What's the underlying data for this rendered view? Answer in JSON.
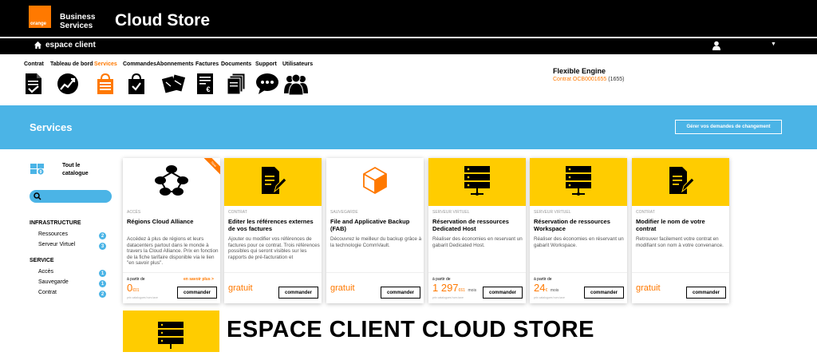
{
  "header": {
    "logo_text": "orange",
    "brand_line1": "Business",
    "brand_line2": "Services",
    "title": "Cloud Store",
    "espace_label": "espace client"
  },
  "nav": [
    {
      "label": "Contrat",
      "icon": "contract-icon"
    },
    {
      "label": "Tableau de bord",
      "icon": "dashboard-icon"
    },
    {
      "label": "Services",
      "icon": "shopping-bag-icon",
      "active": true
    },
    {
      "label": "Commandes",
      "icon": "orders-bag-icon"
    },
    {
      "label": "Abonnements",
      "icon": "subscriptions-icon"
    },
    {
      "label": "Factures",
      "icon": "invoice-icon"
    },
    {
      "label": "Documents",
      "icon": "documents-icon"
    },
    {
      "label": "Support",
      "icon": "support-chat-icon"
    },
    {
      "label": "Utilisateurs",
      "icon": "users-icon"
    }
  ],
  "account": {
    "name": "Flexible Engine",
    "contract_prefix": "Contrat OCB0001655",
    "contract_suffix": "(1655)"
  },
  "banner": {
    "title": "Services",
    "button_label": "Gérer vos demandes de changement"
  },
  "sidebar": {
    "catalog_badge": "9",
    "catalog_line1": "Tout le",
    "catalog_line2": "catalogue",
    "sections": [
      {
        "title": "INFRASTRUCTURE",
        "items": [
          {
            "label": "Ressources",
            "count": "2"
          },
          {
            "label": "Serveur Virtuel",
            "count": "3"
          }
        ]
      },
      {
        "title": "SERVICE",
        "items": [
          {
            "label": "Accès",
            "count": "1"
          },
          {
            "label": "Sauvegarde",
            "count": "1"
          },
          {
            "label": "Contrat",
            "count": "2"
          }
        ]
      }
    ]
  },
  "cards": [
    {
      "category": "ACCÈS",
      "title": "Régions Cloud Alliance",
      "description": "Accédez à plus de régions et leurs datacenters partout dans le monde à travers la Cloud Alliance. Prix en fonction de la fiche tarifaire disponible via le lien \"en savoir plus\".",
      "price_prefix": "à partir de",
      "price": "0",
      "price_unit": "€01",
      "note": "prix catalogues hors taxe",
      "more": "en savoir plus >",
      "button": "commander",
      "ribbon": "New",
      "icon": "cloud-network-icon"
    },
    {
      "category": "CONTRAT",
      "title": "Editer les références externes de vos factures",
      "description": "Ajouter ou modifier vos références de factures pour ce contrat. Trois références possibles qui seront visibles sur les rapports de pré-facturation et",
      "free": "gratuit",
      "button": "commander",
      "icon": "edit-document-icon"
    },
    {
      "category": "SAUVEGARDE",
      "title": "File and Applicative Backup (FAB)",
      "description": "Découvrez le meilleur du backup grâce à la technologie CommVault.",
      "free": "gratuit",
      "button": "commander",
      "icon": "backup-box-icon"
    },
    {
      "category": "SERVEUR VIRTUEL",
      "title": "Réservation de ressources Dedicated Host",
      "description": "Réaliser des économies en reservant un gabarit Dedicated Host.",
      "price_prefix": "à partir de",
      "price": "1 297",
      "price_unit": "€61",
      "price_period": "mois",
      "note": "prix catalogues hors taxe",
      "button": "commander",
      "icon": "server-icon"
    },
    {
      "category": "SERVEUR VIRTUEL",
      "title": "Réservation de ressources Workspace",
      "description": "Réaliser des économies en réservant un gabarit Workspace.",
      "price_prefix": "à partir de",
      "price": "24",
      "price_unit": "€",
      "price_period": "mois",
      "note": "prix catalogues hors taxe",
      "button": "commander",
      "icon": "server-icon"
    },
    {
      "category": "CONTRAT",
      "title": "Modifier le nom de votre contrat",
      "description": "Retrouver facilement votre contrat en modifiant son nom à votre convenance.",
      "free": "gratuit",
      "button": "commander",
      "icon": "edit-document-icon"
    }
  ],
  "overlay_title": "ESPACE CLIENT CLOUD STORE",
  "colors": {
    "orange": "#ff7900",
    "yellow": "#ffcc00",
    "blue": "#4bb4e6"
  }
}
